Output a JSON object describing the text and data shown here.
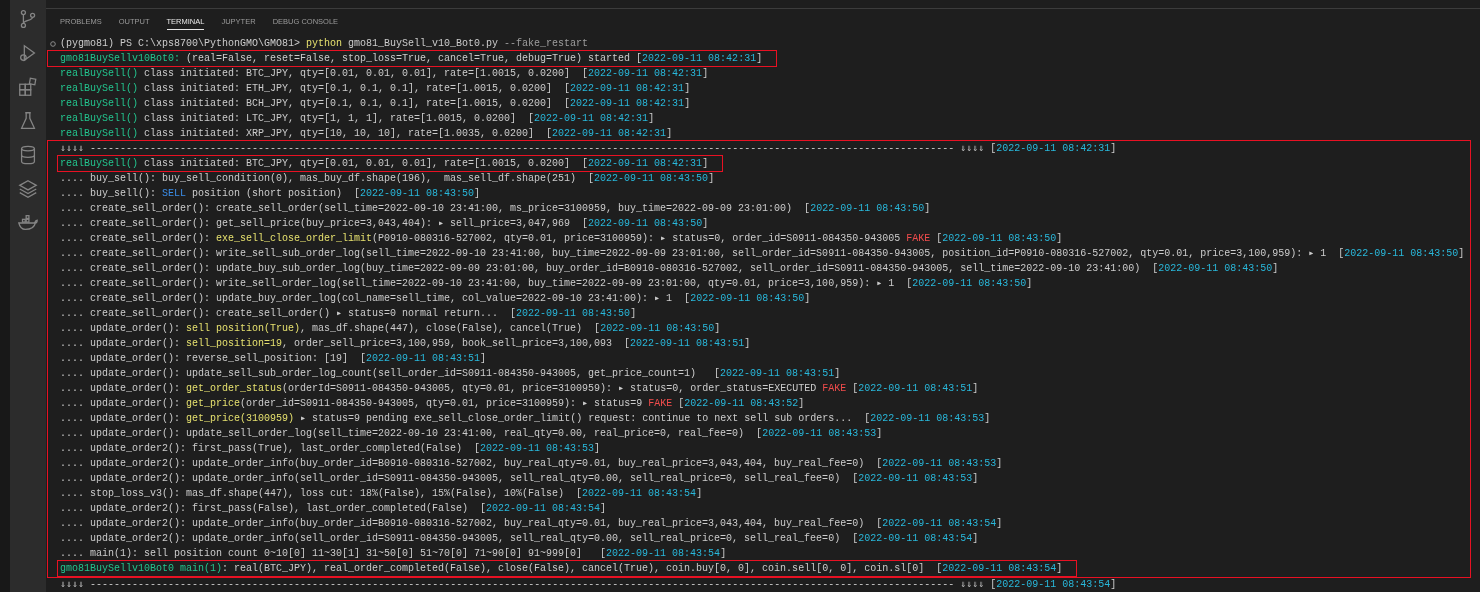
{
  "panel_tabs": [
    {
      "label": "PROBLEMS",
      "selected": false
    },
    {
      "label": "OUTPUT",
      "selected": false
    },
    {
      "label": "TERMINAL",
      "selected": true
    },
    {
      "label": "JUPYTER",
      "selected": false
    },
    {
      "label": "DEBUG CONSOLE",
      "selected": false
    }
  ],
  "terminal": {
    "command_line": {
      "segments": [
        {
          "kind": "text",
          "text": "(pygmo81) PS C:\\xps8700\\PythonGMO\\GMO81> "
        },
        {
          "kind": "call",
          "text": "python"
        },
        {
          "kind": "text",
          "text": " gmo81_BuySell_v10_Bot0.py "
        },
        {
          "kind": "arg",
          "text": "--fake_restart"
        }
      ]
    },
    "lines": [
      {
        "boxed": true,
        "segments": [
          {
            "kind": "func",
            "text": "gmo81BuySellv10Bot0:"
          },
          {
            "kind": "text",
            "text": " (real=False, reset=False, stop_loss=True, cancel=True, debug=True) started ["
          },
          {
            "kind": "time",
            "text": "2022-09-11 08:42:31"
          },
          {
            "kind": "text",
            "text": "]"
          }
        ]
      },
      {
        "boxed": false,
        "segments": [
          {
            "kind": "func",
            "text": "realBuySell()"
          },
          {
            "kind": "text",
            "text": " class initiated: BTC_JPY, qty=[0.01, 0.01, 0.01], rate=[1.0015, 0.0200]  ["
          },
          {
            "kind": "time",
            "text": "2022-09-11 08:42:31"
          },
          {
            "kind": "text",
            "text": "]"
          }
        ]
      },
      {
        "boxed": false,
        "segments": [
          {
            "kind": "func",
            "text": "realBuySell()"
          },
          {
            "kind": "text",
            "text": " class initiated: ETH_JPY, qty=[0.1, 0.1, 0.1], rate=[1.0015, 0.0200]  ["
          },
          {
            "kind": "time",
            "text": "2022-09-11 08:42:31"
          },
          {
            "kind": "text",
            "text": "]"
          }
        ]
      },
      {
        "boxed": false,
        "segments": [
          {
            "kind": "func",
            "text": "realBuySell()"
          },
          {
            "kind": "text",
            "text": " class initiated: BCH_JPY, qty=[0.1, 0.1, 0.1], rate=[1.0015, 0.0200]  ["
          },
          {
            "kind": "time",
            "text": "2022-09-11 08:42:31"
          },
          {
            "kind": "text",
            "text": "]"
          }
        ]
      },
      {
        "boxed": false,
        "segments": [
          {
            "kind": "func",
            "text": "realBuySell()"
          },
          {
            "kind": "text",
            "text": " class initiated: LTC_JPY, qty=[1, 1, 1], rate=[1.0015, 0.0200]  ["
          },
          {
            "kind": "time",
            "text": "2022-09-11 08:42:31"
          },
          {
            "kind": "text",
            "text": "]"
          }
        ]
      },
      {
        "boxed": false,
        "segments": [
          {
            "kind": "func",
            "text": "realBuySell()"
          },
          {
            "kind": "text",
            "text": " class initiated: XRP_JPY, qty=[10, 10, 10], rate=[1.0035, 0.0200]  ["
          },
          {
            "kind": "time",
            "text": "2022-09-11 08:42:31"
          },
          {
            "kind": "text",
            "text": "]"
          }
        ]
      }
    ],
    "annotation_box": {
      "lines": [
        {
          "boxed": false,
          "segments": [
            {
              "kind": "text",
              "text": "⇓⇓⇓⇓ ------------------------------------------------------------------------------------------------------------------------------------------------ ⇓⇓⇓⇓ ["
            },
            {
              "kind": "time",
              "text": "2022-09-11 08:42:31"
            },
            {
              "kind": "text",
              "text": "]"
            }
          ]
        },
        {
          "boxed": true,
          "segments": [
            {
              "kind": "func",
              "text": "realBuySell()"
            },
            {
              "kind": "text",
              "text": " class initiated: BTC_JPY, qty=[0.01, 0.01, 0.01], rate=[1.0015, 0.0200]  ["
            },
            {
              "kind": "time",
              "text": "2022-09-11 08:42:31"
            },
            {
              "kind": "text",
              "text": "]"
            }
          ]
        },
        {
          "boxed": false,
          "segments": [
            {
              "kind": "text",
              "text": ".... buy_sell(): buy_sell_condition(0), mas_buy_df.shape(196),  mas_sell_df.shape(251)  ["
            },
            {
              "kind": "time",
              "text": "2022-09-11 08:43:50"
            },
            {
              "kind": "text",
              "text": "]"
            }
          ]
        },
        {
          "boxed": false,
          "segments": [
            {
              "kind": "text",
              "text": ".... buy_sell(): "
            },
            {
              "kind": "keyword",
              "text": "SELL"
            },
            {
              "kind": "text",
              "text": " position (short position)  ["
            },
            {
              "kind": "time",
              "text": "2022-09-11 08:43:50"
            },
            {
              "kind": "text",
              "text": "]"
            }
          ]
        },
        {
          "boxed": false,
          "segments": [
            {
              "kind": "text",
              "text": ".... create_sell_order(): create_sell_order(sell_time=2022-09-10 23:41:00, ms_price=3100959, buy_time=2022-09-09 23:01:00)  ["
            },
            {
              "kind": "time",
              "text": "2022-09-11 08:43:50"
            },
            {
              "kind": "text",
              "text": "]"
            }
          ]
        },
        {
          "boxed": false,
          "segments": [
            {
              "kind": "text",
              "text": ".... create_sell_order(): get_sell_price(buy_price=3,043,404): ▸ sell_price=3,047,969  ["
            },
            {
              "kind": "time",
              "text": "2022-09-11 08:43:50"
            },
            {
              "kind": "text",
              "text": "]"
            }
          ]
        },
        {
          "boxed": false,
          "segments": [
            {
              "kind": "text",
              "text": ".... create_sell_order(): "
            },
            {
              "kind": "call",
              "text": "exe_sell_close_order_limit"
            },
            {
              "kind": "text",
              "text": "(P0910-080316-527002, qty=0.01, price=3100959): ▸ status=0, order_id=S0911-084350-943005 "
            },
            {
              "kind": "fake",
              "text": "FAKE"
            },
            {
              "kind": "text",
              "text": " ["
            },
            {
              "kind": "time",
              "text": "2022-09-11 08:43:50"
            },
            {
              "kind": "text",
              "text": "]"
            }
          ]
        },
        {
          "boxed": false,
          "segments": [
            {
              "kind": "text",
              "text": ".... create_sell_order(): write_sell_sub_order_log(sell_time=2022-09-10 23:41:00, buy_time=2022-09-09 23:01:00, sell_order_id=S0911-084350-943005, position_id=P0910-080316-527002, qty=0.01, price=3,100,959): ▸ 1  ["
            },
            {
              "kind": "time",
              "text": "2022-09-11 08:43:50"
            },
            {
              "kind": "text",
              "text": "]"
            }
          ]
        },
        {
          "boxed": false,
          "segments": [
            {
              "kind": "text",
              "text": ".... create_sell_order(): update_buy_sub_order_log(buy_time=2022-09-09 23:01:00, buy_order_id=B0910-080316-527002, sell_order_id=S0911-084350-943005, sell_time=2022-09-10 23:41:00)  ["
            },
            {
              "kind": "time",
              "text": "2022-09-11 08:43:50"
            },
            {
              "kind": "text",
              "text": "]"
            }
          ]
        },
        {
          "boxed": false,
          "segments": [
            {
              "kind": "text",
              "text": ".... create_sell_order(): write_sell_order_log(sell_time=2022-09-10 23:41:00, buy_time=2022-09-09 23:01:00, qty=0.01, price=3,100,959): ▸ 1  ["
            },
            {
              "kind": "time",
              "text": "2022-09-11 08:43:50"
            },
            {
              "kind": "text",
              "text": "]"
            }
          ]
        },
        {
          "boxed": false,
          "segments": [
            {
              "kind": "text",
              "text": ".... create_sell_order(): update_buy_order_log(col_name=sell_time, col_value=2022-09-10 23:41:00): ▸ 1  ["
            },
            {
              "kind": "time",
              "text": "2022-09-11 08:43:50"
            },
            {
              "kind": "text",
              "text": "]"
            }
          ]
        },
        {
          "boxed": false,
          "segments": [
            {
              "kind": "text",
              "text": ".... create_sell_order(): create_sell_order() ▸ status=0 normal return...  ["
            },
            {
              "kind": "time",
              "text": "2022-09-11 08:43:50"
            },
            {
              "kind": "text",
              "text": "]"
            }
          ]
        },
        {
          "boxed": false,
          "segments": [
            {
              "kind": "text",
              "text": ".... update_order(): "
            },
            {
              "kind": "call",
              "text": "sell position(True)"
            },
            {
              "kind": "text",
              "text": ", mas_df.shape(447), close(False), cancel(True)  ["
            },
            {
              "kind": "time",
              "text": "2022-09-11 08:43:50"
            },
            {
              "kind": "text",
              "text": "]"
            }
          ]
        },
        {
          "boxed": false,
          "segments": [
            {
              "kind": "text",
              "text": ".... update_order(): "
            },
            {
              "kind": "call",
              "text": "sell_position=19"
            },
            {
              "kind": "text",
              "text": ", order_sell_price=3,100,959, book_sell_price=3,100,093  ["
            },
            {
              "kind": "time",
              "text": "2022-09-11 08:43:51"
            },
            {
              "kind": "text",
              "text": "]"
            }
          ]
        },
        {
          "boxed": false,
          "segments": [
            {
              "kind": "text",
              "text": ".... update_order(): reverse_sell_position: [19]  ["
            },
            {
              "kind": "time",
              "text": "2022-09-11 08:43:51"
            },
            {
              "kind": "text",
              "text": "]"
            }
          ]
        },
        {
          "boxed": false,
          "segments": [
            {
              "kind": "text",
              "text": ".... update_order(): update_sell_sub_order_log_count(sell_order_id=S0911-084350-943005, get_price_count=1)   ["
            },
            {
              "kind": "time",
              "text": "2022-09-11 08:43:51"
            },
            {
              "kind": "text",
              "text": "]"
            }
          ]
        },
        {
          "boxed": false,
          "segments": [
            {
              "kind": "text",
              "text": ".... update_order(): "
            },
            {
              "kind": "call",
              "text": "get_order_status"
            },
            {
              "kind": "text",
              "text": "(orderId=S0911-084350-943005, qty=0.01, price=3100959): ▸ status=0, order_status=EXECUTED "
            },
            {
              "kind": "fake",
              "text": "FAKE"
            },
            {
              "kind": "text",
              "text": " ["
            },
            {
              "kind": "time",
              "text": "2022-09-11 08:43:51"
            },
            {
              "kind": "text",
              "text": "]"
            }
          ]
        },
        {
          "boxed": false,
          "segments": [
            {
              "kind": "text",
              "text": ".... update_order(): "
            },
            {
              "kind": "call",
              "text": "get_price"
            },
            {
              "kind": "text",
              "text": "(order_id=S0911-084350-943005, qty=0.01, price=3100959): ▸ status=9 "
            },
            {
              "kind": "fake",
              "text": "FAKE"
            },
            {
              "kind": "text",
              "text": " ["
            },
            {
              "kind": "time",
              "text": "2022-09-11 08:43:52"
            },
            {
              "kind": "text",
              "text": "]"
            }
          ]
        },
        {
          "boxed": false,
          "segments": [
            {
              "kind": "text",
              "text": ".... update_order(): "
            },
            {
              "kind": "call",
              "text": "get_price(3100959)"
            },
            {
              "kind": "text",
              "text": " ▸ status=9 pending exe_sell_close_order_limit() request: continue to next sell sub orders...  ["
            },
            {
              "kind": "time",
              "text": "2022-09-11 08:43:53"
            },
            {
              "kind": "text",
              "text": "]"
            }
          ]
        },
        {
          "boxed": false,
          "segments": [
            {
              "kind": "text",
              "text": ".... update_order(): update_sell_order_log(sell_time=2022-09-10 23:41:00, real_qty=0.00, real_price=0, real_fee=0)  ["
            },
            {
              "kind": "time",
              "text": "2022-09-11 08:43:53"
            },
            {
              "kind": "text",
              "text": "]"
            }
          ]
        },
        {
          "boxed": false,
          "segments": [
            {
              "kind": "text",
              "text": ".... update_order2(): first_pass(True), last_order_completed(False)  ["
            },
            {
              "kind": "time",
              "text": "2022-09-11 08:43:53"
            },
            {
              "kind": "text",
              "text": "]"
            }
          ]
        },
        {
          "boxed": false,
          "segments": [
            {
              "kind": "text",
              "text": ".... update_order2(): update_order_info(buy_order_id=B0910-080316-527002, buy_real_qty=0.01, buy_real_price=3,043,404, buy_real_fee=0)  ["
            },
            {
              "kind": "time",
              "text": "2022-09-11 08:43:53"
            },
            {
              "kind": "text",
              "text": "]"
            }
          ]
        },
        {
          "boxed": false,
          "segments": [
            {
              "kind": "text",
              "text": ".... update_order2(): update_order_info(sell_order_id=S0911-084350-943005, sell_real_qty=0.00, sell_real_price=0, sell_real_fee=0)  ["
            },
            {
              "kind": "time",
              "text": "2022-09-11 08:43:53"
            },
            {
              "kind": "text",
              "text": "]"
            }
          ]
        },
        {
          "boxed": false,
          "segments": [
            {
              "kind": "text",
              "text": ".... stop_loss_v3(): mas_df.shape(447), loss cut: 18%(False), 15%(False), 10%(False)  ["
            },
            {
              "kind": "time",
              "text": "2022-09-11 08:43:54"
            },
            {
              "kind": "text",
              "text": "]"
            }
          ]
        },
        {
          "boxed": false,
          "segments": [
            {
              "kind": "text",
              "text": ".... update_order2(): first_pass(False), last_order_completed(False)  ["
            },
            {
              "kind": "time",
              "text": "2022-09-11 08:43:54"
            },
            {
              "kind": "text",
              "text": "]"
            }
          ]
        },
        {
          "boxed": false,
          "segments": [
            {
              "kind": "text",
              "text": ".... update_order2(): update_order_info(buy_order_id=B0910-080316-527002, buy_real_qty=0.01, buy_real_price=3,043,404, buy_real_fee=0)  ["
            },
            {
              "kind": "time",
              "text": "2022-09-11 08:43:54"
            },
            {
              "kind": "text",
              "text": "]"
            }
          ]
        },
        {
          "boxed": false,
          "segments": [
            {
              "kind": "text",
              "text": ".... update_order2(): update_order_info(sell_order_id=S0911-084350-943005, sell_real_qty=0.00, sell_real_price=0, sell_real_fee=0)  ["
            },
            {
              "kind": "time",
              "text": "2022-09-11 08:43:54"
            },
            {
              "kind": "text",
              "text": "]"
            }
          ]
        },
        {
          "boxed": false,
          "segments": [
            {
              "kind": "text",
              "text": ".... main(1): sell position count 0~10[0] 11~30[1] 31~50[0] 51~70[0] 71~90[0] 91~999[0]   ["
            },
            {
              "kind": "time",
              "text": "2022-09-11 08:43:54"
            },
            {
              "kind": "text",
              "text": "]"
            }
          ]
        },
        {
          "boxed": true,
          "segments": [
            {
              "kind": "func",
              "text": "gmo81BuySellv10Bot0 main(1)"
            },
            {
              "kind": "text",
              "text": ": real(BTC_JPY), real_order_completed(False), close(False), cancel(True), coin.buy[0, 0], coin.sell[0, 0], coin.sl[0]  ["
            },
            {
              "kind": "time",
              "text": "2022-09-11 08:43:54"
            },
            {
              "kind": "text",
              "text": "]"
            }
          ]
        }
      ]
    },
    "lines_after": [
      {
        "boxed": false,
        "segments": [
          {
            "kind": "text",
            "text": "⇓⇓⇓⇓ ------------------------------------------------------------------------------------------------------------------------------------------------ ⇓⇓⇓⇓ ["
          },
          {
            "kind": "time",
            "text": "2022-09-11 08:43:54"
          },
          {
            "kind": "text",
            "text": "]"
          }
        ]
      }
    ]
  }
}
